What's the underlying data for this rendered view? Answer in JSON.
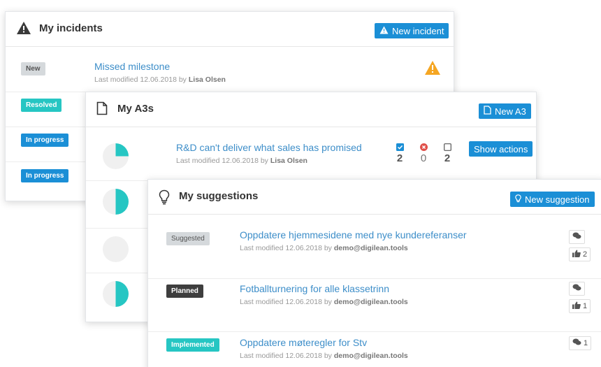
{
  "incidents": {
    "title": "My incidents",
    "new_button": "New incident",
    "rows": [
      {
        "status": "New",
        "title": "Missed milestone",
        "meta_prefix": "Last modified 12.06.2018 by",
        "author": "Lisa Olsen"
      },
      {
        "status": "Resolved"
      },
      {
        "status": "In progress"
      },
      {
        "status": "In progress"
      }
    ]
  },
  "a3s": {
    "title": "My A3s",
    "new_button": "New A3",
    "rows": [
      {
        "title": "R&D can't deliver what sales has promised",
        "meta_prefix": "Last modified 12.06.2018 by",
        "author": "Lisa Olsen",
        "counts": {
          "done": "2",
          "failed": "0",
          "open": "2"
        },
        "action": "Show actions"
      }
    ],
    "progress": [
      0.25,
      0.5,
      0,
      0.5
    ]
  },
  "suggestions": {
    "title": "My suggestions",
    "new_button": "New suggestion",
    "rows": [
      {
        "status": "Suggested",
        "title": "Oppdatere hjemmesidene med nye kundereferanser",
        "meta_prefix": "Last modified 12.06.2018 by",
        "author": "demo@digilean.tools",
        "likes": "2"
      },
      {
        "status": "Planned",
        "title": "Fotballturnering for alle klassetrinn",
        "meta_prefix": "Last modified 12.06.2018 by",
        "author": "demo@digilean.tools",
        "likes": "1"
      },
      {
        "status": "Implemented",
        "title": "Oppdatere møteregler for Stv",
        "meta_prefix": "Last modified 12.06.2018 by",
        "author": "demo@digilean.tools",
        "comments": "1"
      }
    ]
  },
  "colors": {
    "accent": "#1b8fd6",
    "new": "#d5d9dc",
    "resolved": "#26c6c3",
    "in_progress": "#1b8fd6",
    "suggested": "#d5d9dc",
    "planned": "#3e3e3e",
    "implemented": "#26c6c3",
    "warning": "#f5a623",
    "pie": "#26c6c3"
  },
  "icons": {
    "incidents": "warning-triangle-icon",
    "a3s": "document-icon",
    "suggestions": "lightbulb-icon",
    "comment": "comments-icon",
    "like": "thumbs-up-icon"
  }
}
